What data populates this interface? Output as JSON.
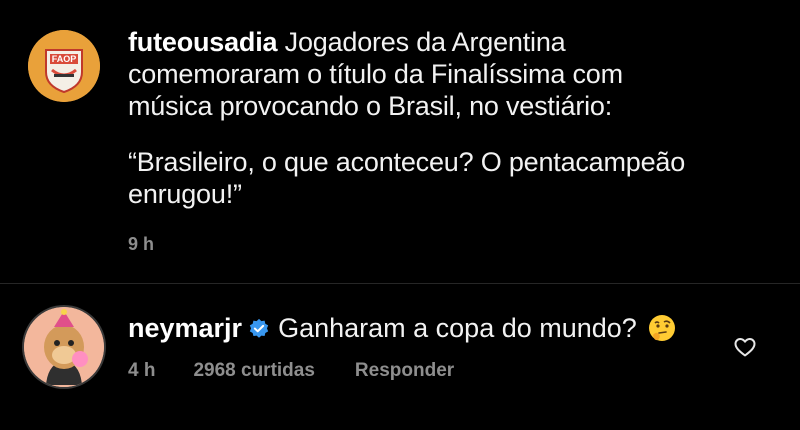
{
  "post": {
    "username": "futeousadia",
    "caption_line_1": "Jogadores da Argentina",
    "caption_line_2": "comemoraram o título da Finalíssima com",
    "caption_line_3": "música provocando o Brasil, no vestiário:",
    "quote_line_1": "“Brasileiro, o que aconteceu? O pentacampeão",
    "quote_line_2": "enrugou!”",
    "time": "9 h",
    "avatar_icon": "futeousadia-logo-icon",
    "avatar_text": "FAOP"
  },
  "comment": {
    "username": "neymarjr",
    "verified_icon": "verified-badge-icon",
    "text": "Ganharam a copa do mundo?",
    "emoji": "thinking-face-emoji",
    "time": "4 h",
    "likes": "2968 curtidas",
    "reply_label": "Responder",
    "like_icon": "heart-outline-icon",
    "avatar_icon": "bored-ape-avatar-icon"
  },
  "colors": {
    "background": "#000000",
    "text": "#f2f2f2",
    "muted": "#8e8e8e",
    "verified": "#3897f0",
    "divider": "#262626"
  }
}
